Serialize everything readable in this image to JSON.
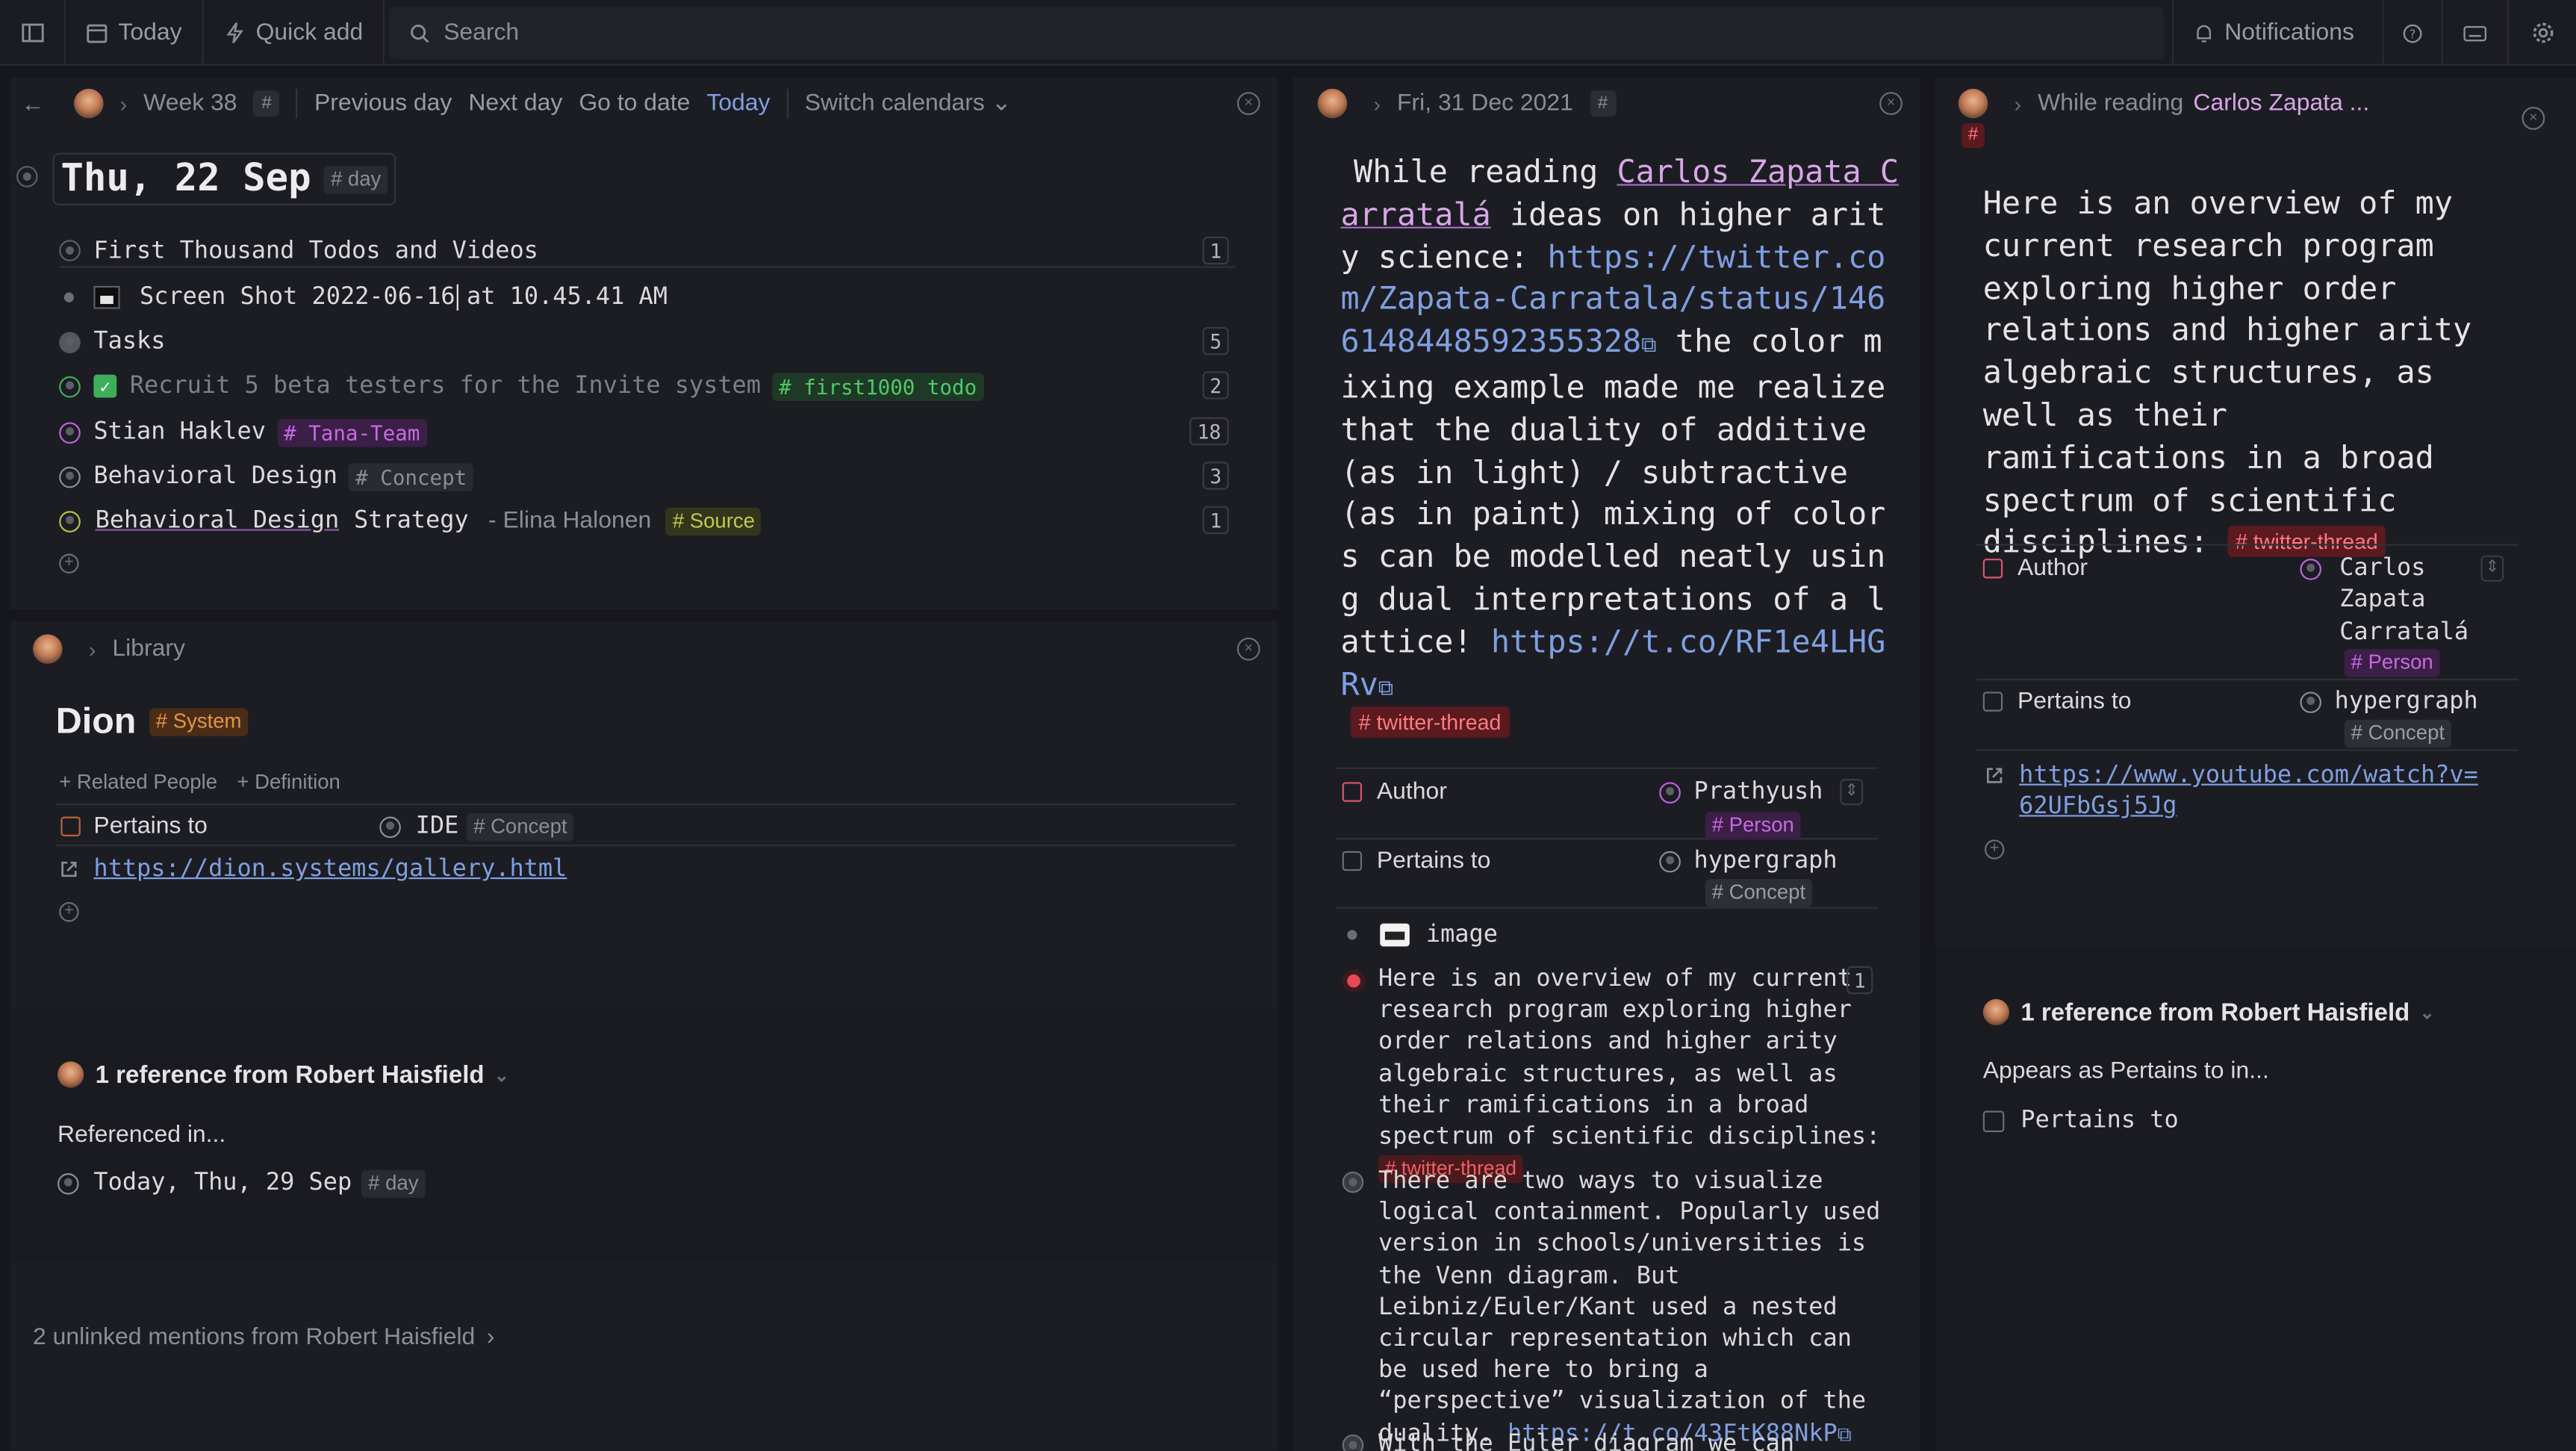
{
  "topbar": {
    "today": "Today",
    "quick_add": "Quick add",
    "search": "Search",
    "notifications": "Notifications"
  },
  "panel1": {
    "header": {
      "week": "Week 38",
      "previous": "Previous day",
      "next": "Next day",
      "goto": "Go to date",
      "today": "Today",
      "switch": "Switch calendars"
    },
    "title": "Thu, 22 Sep",
    "title_tag": "# day",
    "items": [
      {
        "text": "First Thousand Todos and Videos",
        "count": "1"
      },
      {
        "text": "Screen Shot 2022-06-16",
        "text2": "at 10.45.41 AM"
      },
      {
        "text": "Tasks",
        "count": "5"
      },
      {
        "text": "Recruit 5 beta testers for the Invite system",
        "tag": "# first1000 todo",
        "count": "2"
      },
      {
        "text": "Stian Haklev",
        "tag": "# Tana-Team",
        "count": "18"
      },
      {
        "text": "Behavioral Design",
        "tag": "# Concept",
        "count": "3"
      },
      {
        "text": "Behavioral Design",
        "text2": "Strategy",
        "text3": "- Elina Halonen",
        "tag": "# Source",
        "count": "1"
      }
    ]
  },
  "panel2": {
    "crumb": "Library",
    "title": "Dion",
    "title_tag": "# System",
    "related": "+ Related People",
    "definition": "+ Definition",
    "field_label": "Pertains to",
    "field_value": "IDE",
    "field_tag": "# Concept",
    "url": "https://dion.systems/gallery.html",
    "reference": "1 reference from Robert Haisfield",
    "referenced_in": "Referenced in...",
    "ref_item": "Today, Thu, 29 Sep",
    "ref_tag": "# day",
    "unlinked": "2 unlinked mentions from Robert Haisfield"
  },
  "panel3": {
    "crumb": "Fri, 31 Dec 2021",
    "text_a": "While reading",
    "person": "Carlos Zapata Carratalá",
    "text_b": "ideas on higher arity science:",
    "url1": "https://twitter.com/Zapata-Carratala/status/1466148448592355328",
    "text_c": "the color mixing example made me realize that the duality of additive (as in light) / subtractive (as in paint) mixing of colors can be modelled neatly using dual interpretations of a lattice!",
    "url2": "https://t.co/RF1e4LHGRv",
    "tag": "# twitter-thread",
    "author_label": "Author",
    "author_value": "Prathyush",
    "author_tag": "# Person",
    "pertains_label": "Pertains to",
    "pertains_value": "hypergraph",
    "pertains_tag": "# Concept",
    "image_label": "image",
    "child1": "Here is an overview of my current research program exploring higher order relations and higher arity algebraic structures, as well as their ramifications in a broad spectrum of scientific disciplines:",
    "child1_count": "1",
    "child2": "There are two ways to visualize logical containment. Popularly used version in schools/universities is the Venn diagram. But Leibniz/Euler/Kant used a nested circular representation which can be used here to bring a “perspective” visualization of the duality.",
    "child2_url": "https://t.co/43FtK88NkP",
    "child3": "With the Euler diagram we can easily"
  },
  "panel4": {
    "crumb": "While reading",
    "crumb2": "Carlos Zapata ...",
    "hash": "#",
    "text": "Here is an overview of my current research program exploring higher order relations and higher arity algebraic structures, as well as their ramifications in a broad spectrum of scientific disciplines:",
    "tag": "# twitter-thread",
    "author_label": "Author",
    "author_l1": "Carlos",
    "author_l2": "Zapata",
    "author_l3": "Carratalá",
    "author_tag": "# Person",
    "pertains_label": "Pertains to",
    "pertains_value": "hypergraph",
    "pertains_tag": "# Concept",
    "url": "https://www.youtube.com/watch?v=62UFbGsj5Jg",
    "reference": "1 reference from Robert Haisfield",
    "appears": "Appears as Pertains to in...",
    "appears_item": "Pertains to"
  }
}
